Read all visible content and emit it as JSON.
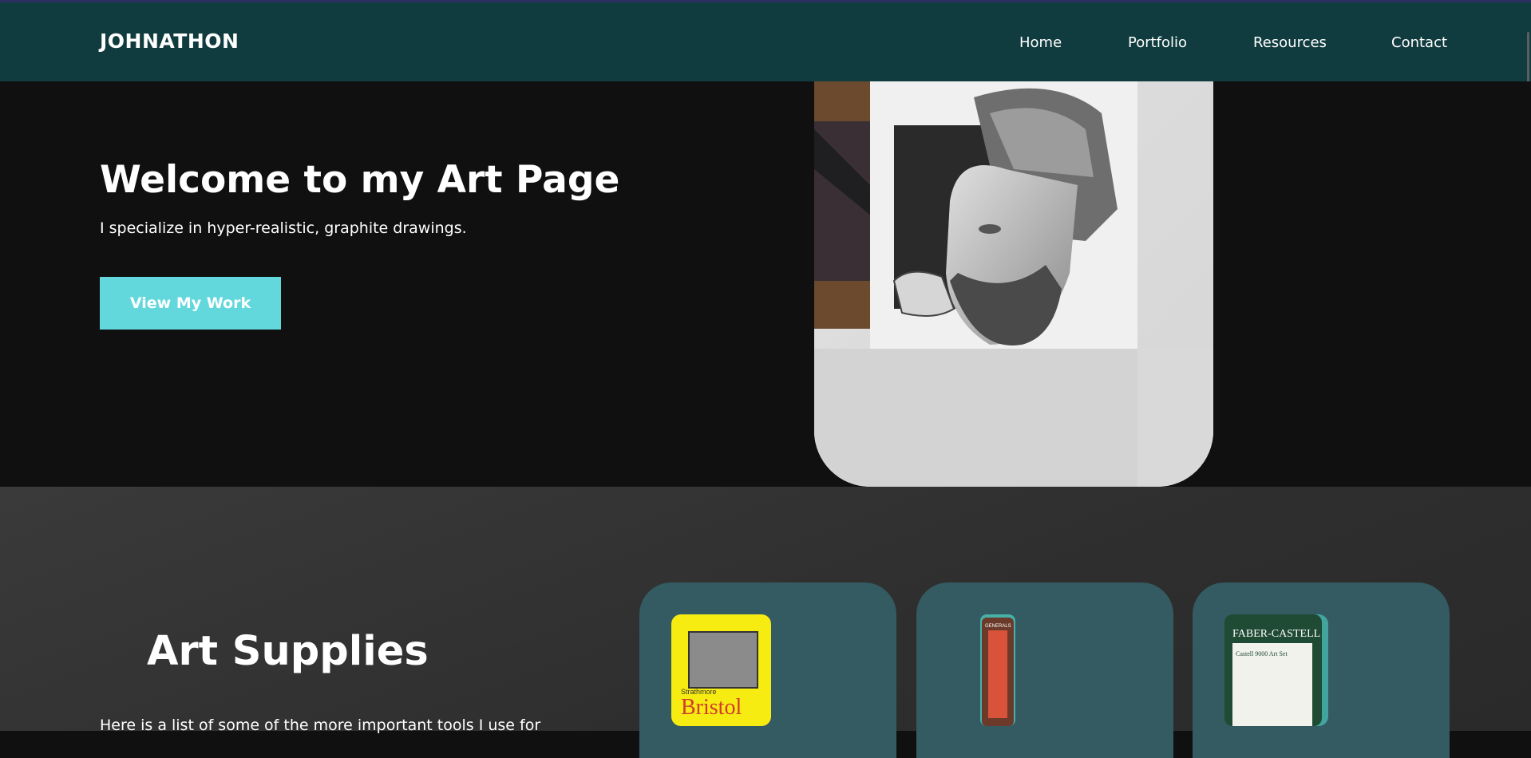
{
  "navbar": {
    "brand": "JOHNATHON",
    "links": [
      "Home",
      "Portfolio",
      "Resources",
      "Contact"
    ]
  },
  "hero": {
    "title": "Welcome to my Art Page",
    "subtitle": "I specialize in hyper-realistic, graphite drawings.",
    "cta_label": "View My Work",
    "image_alt": "graphite-portrait-drawing"
  },
  "supplies": {
    "title": "Art Supplies",
    "description": "Here is a list of some of the more important tools I use for",
    "cards": [
      {
        "product_text": "Bristol",
        "brand_text": "Strathmore"
      },
      {
        "product_text": "",
        "brand_text": "GENERALS"
      },
      {
        "product_text": "Castell 9000 Art Set",
        "brand_text": "FABER-CASTELL"
      }
    ]
  },
  "colors": {
    "navbar": "#113c3f",
    "hero_bg": "#111011",
    "accent": "#62d8dc",
    "card_bg": "#345a62"
  }
}
